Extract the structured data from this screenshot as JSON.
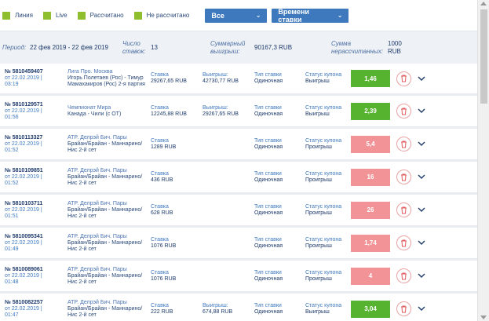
{
  "filters": {
    "checkboxes": [
      {
        "label": "Линия"
      },
      {
        "label": "Live"
      },
      {
        "label": "Рассчитано"
      },
      {
        "label": "Не рассчитано"
      }
    ],
    "type_select": "Все",
    "time_select": "Времени ставки"
  },
  "summary": {
    "period_label": "Период:",
    "period_value": "22 фев 2019 - 22 фев 2019",
    "count_label": "Число ставок:",
    "count_value": "13",
    "total_win_label": "Суммарный выигрыш:",
    "total_win_value": "90167,3 RUB",
    "unsettled_label": "Сумма нерассчитанных:",
    "unsettled_value": "1000 RUB"
  },
  "colors": {
    "win": "#56b32f",
    "lost": "#f29497",
    "accent": "#3e79be"
  },
  "bets": [
    {
      "id": "№ 5810459407",
      "date": "от 22.02.2019 | 03:19",
      "league": "Лига Про. Москва",
      "event": "Игорь Полетаев (Рос) - Тимур Мамахакиров (Рос) 2-я партия",
      "stake_label": "Ставка",
      "stake": "29267,65 RUB",
      "win_label": "Выигрыш:",
      "win": "42730,77 RUB",
      "type_label": "Тип ставки",
      "type": "Одиночная",
      "status_label": "Статус купона",
      "status": "Выигрыш",
      "coef": "1,46",
      "result": "win"
    },
    {
      "id": "№ 5810129571",
      "date": "от 22.02.2019 | 01:56",
      "league": "Чемпионат Мира",
      "event": "Канада - Чили (с ОТ)",
      "stake_label": "Ставка",
      "stake": "12245,88 RUB",
      "win_label": "Выигрыш:",
      "win": "29267,65 RUB",
      "type_label": "Тип ставки",
      "type": "Одиночная",
      "status_label": "Статус купона",
      "status": "Выигрыш",
      "coef": "2,39",
      "result": "win"
    },
    {
      "id": "№ 5810113327",
      "date": "от 22.02.2019 | 01:52",
      "league": "ATP. Делрэй Бич. Пары",
      "event": "Брайан/Брайан - Маннарино/Нис 2-й сет",
      "stake_label": "Ставка",
      "stake": "1289 RUB",
      "win_label": "",
      "win": "",
      "type_label": "Тип ставки",
      "type": "Одиночная",
      "status_label": "Статус купона",
      "status": "Проигрыш",
      "coef": "5,4",
      "result": "lost"
    },
    {
      "id": "№ 5810109851",
      "date": "от 22.02.2019 | 01:52",
      "league": "ATP. Делрэй Бич. Пары",
      "event": "Брайан/Брайан - Маннарино/Нис 2-й сет",
      "stake_label": "Ставка",
      "stake": "436 RUB",
      "win_label": "",
      "win": "",
      "type_label": "Тип ставки",
      "type": "Одиночная",
      "status_label": "Статус купона",
      "status": "Проигрыш",
      "coef": "16",
      "result": "lost"
    },
    {
      "id": "№ 5810103711",
      "date": "от 22.02.2019 | 01:51",
      "league": "ATP. Делрэй Бич. Пары",
      "event": "Брайан/Брайан - Маннарино/Нис 2-й сет",
      "stake_label": "Ставка",
      "stake": "628 RUB",
      "win_label": "",
      "win": "",
      "type_label": "Тип ставки",
      "type": "Одиночная",
      "status_label": "Статус купона",
      "status": "Проигрыш",
      "coef": "26",
      "result": "lost"
    },
    {
      "id": "№ 5810095341",
      "date": "от 22.02.2019 | 01:49",
      "league": "ATP. Делрэй Бич. Пары",
      "event": "Брайан/Брайан - Маннарино/Нис 2-й сет",
      "stake_label": "Ставка",
      "stake": "1076 RUB",
      "win_label": "",
      "win": "",
      "type_label": "Тип ставки",
      "type": "Одиночная",
      "status_label": "Статус купона",
      "status": "Проигрыш",
      "coef": "1,74",
      "result": "lost"
    },
    {
      "id": "№ 5810089061",
      "date": "от 22.02.2019 | 01:48",
      "league": "ATP. Делрэй Бич. Пары",
      "event": "Брайан/Брайан - Маннарино/Нис 2-й сет",
      "stake_label": "Ставка",
      "stake": "1076 RUB",
      "win_label": "",
      "win": "",
      "type_label": "Тип ставки",
      "type": "Одиночная",
      "status_label": "Статус купона",
      "status": "Проигрыш",
      "coef": "4",
      "result": "lost"
    },
    {
      "id": "№ 5810082257",
      "date": "от 22.02.2019 | 01:47",
      "league": "ATP. Делрэй Бич. Пары",
      "event": "Брайан/Брайан - Маннарино/Нис 2-й сет",
      "stake_label": "Ставка",
      "stake": "222 RUB",
      "win_label": "Выигрыш:",
      "win": "674,88 RUB",
      "type_label": "Тип ставки",
      "type": "Одиночная",
      "status_label": "Статус купона",
      "status": "Выигрыш",
      "coef": "3,04",
      "result": "win"
    }
  ]
}
